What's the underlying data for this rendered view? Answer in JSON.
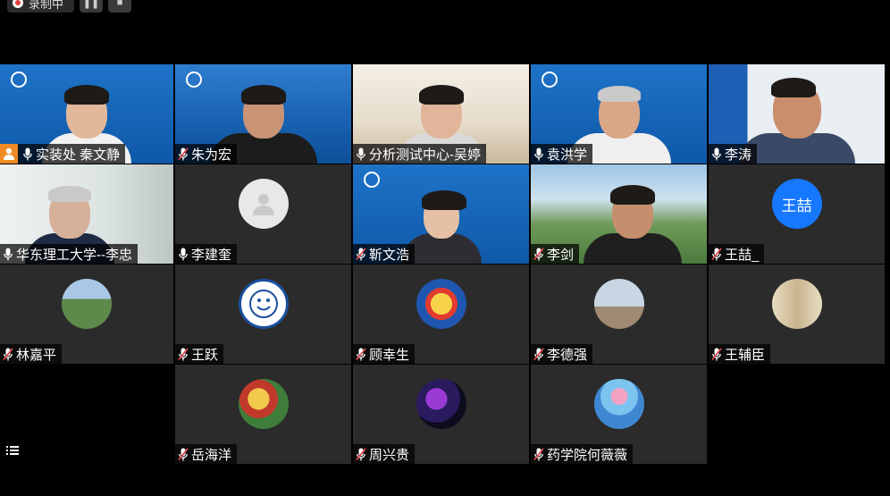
{
  "recording": {
    "label": "录制中"
  },
  "participants": [
    {
      "name": "实装处 秦文静",
      "host": true,
      "mic": "on"
    },
    {
      "name": "朱为宏",
      "mic": "muted"
    },
    {
      "name": "分析测试中心-吴婷",
      "mic": "on"
    },
    {
      "name": "袁洪学",
      "mic": "on"
    },
    {
      "name": "李涛",
      "mic": "on"
    },
    {
      "name": "华东理工大学--李忠",
      "mic": "on"
    },
    {
      "name": "李建奎",
      "mic": "on"
    },
    {
      "name": "靳文浩",
      "mic": "muted"
    },
    {
      "name": "李剑",
      "mic": "muted"
    },
    {
      "name": "王喆_",
      "mic": "muted",
      "initials": "王喆"
    },
    {
      "name": "林嘉平",
      "mic": "muted"
    },
    {
      "name": "王跃",
      "mic": "muted"
    },
    {
      "name": "顾幸生",
      "mic": "muted"
    },
    {
      "name": "李德强",
      "mic": "muted"
    },
    {
      "name": "王辅臣",
      "mic": "muted"
    },
    {
      "name": "岳海洋",
      "mic": "muted"
    },
    {
      "name": "周兴贵",
      "mic": "muted"
    },
    {
      "name": "药学院何薇薇",
      "mic": "muted"
    }
  ],
  "colors": {
    "muted_mic": "#e5484d",
    "host_badge": "#f08a24",
    "avatar_initial_bg": "#1677ff",
    "tile_bg": "#2b2b2b"
  }
}
